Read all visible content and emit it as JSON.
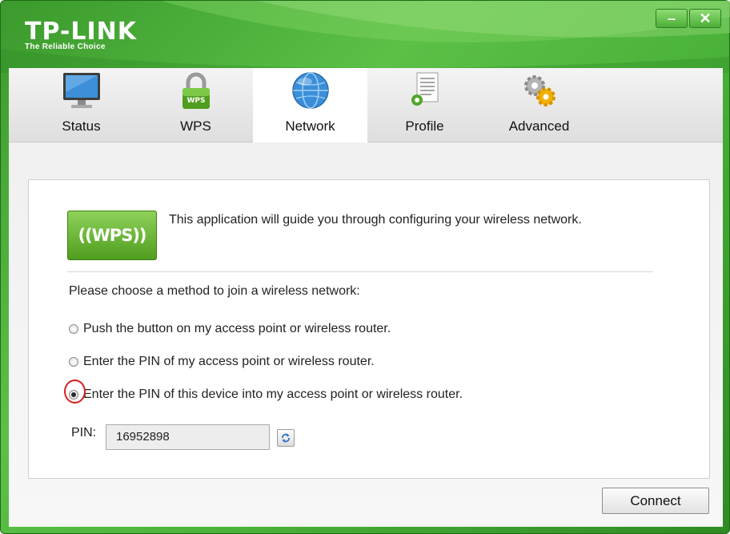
{
  "brand": {
    "name": "TP-LINK",
    "tagline": "The Reliable Choice"
  },
  "window_controls": {
    "minimize": "–",
    "close": "✕"
  },
  "tabs": [
    {
      "label": "Status",
      "icon": "monitor-icon"
    },
    {
      "label": "WPS",
      "icon": "wps-lock-icon"
    },
    {
      "label": "Network",
      "icon": "globe-icon",
      "active": true
    },
    {
      "label": "Profile",
      "icon": "profile-document-icon"
    },
    {
      "label": "Advanced",
      "icon": "gears-icon"
    }
  ],
  "wps": {
    "logo_text": "((WPS))",
    "intro": "This application will guide you through configuring your wireless network.",
    "prompt": "Please choose a method to join a wireless network:",
    "options": [
      {
        "label": "Push the button on my access point or wireless router.",
        "selected": false
      },
      {
        "label": "Enter the PIN of my access point or wireless router.",
        "selected": false
      },
      {
        "label": "Enter the PIN of this device into my access point or wireless router.",
        "selected": true
      }
    ],
    "pin_label": "PIN:",
    "pin_value": "16952898",
    "refresh_icon": "refresh-icon"
  },
  "actions": {
    "connect": "Connect"
  },
  "colors": {
    "brand_green": "#4bb23a",
    "highlight_red": "#d62020"
  }
}
